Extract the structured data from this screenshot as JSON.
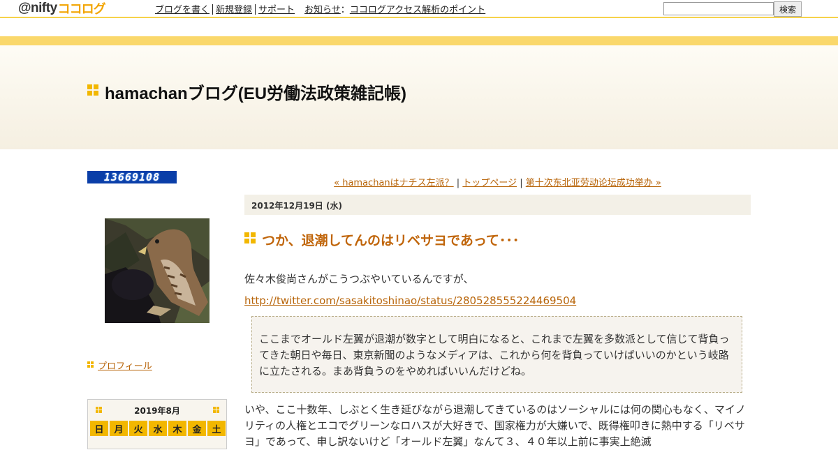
{
  "topbar": {
    "logo_prefix": "@nifty",
    "logo_suffix": "ココログ",
    "nav": [
      "ブログを書く",
      "新規登録",
      "サポート"
    ],
    "news_label": "お知らせ",
    "news_colon": "：",
    "news_link": "ココログアクセス解析のポイント",
    "search_placeholder": "",
    "search_button": "検索"
  },
  "blog": {
    "title": "hamachanブログ(EU労働法政策雑記帳)"
  },
  "sidebar": {
    "counter": "13669108",
    "profile_link": "プロフィール",
    "calendar": {
      "title": "2019年8月",
      "weekdays": [
        "日",
        "月",
        "火",
        "水",
        "木",
        "金",
        "土"
      ]
    }
  },
  "post_nav": {
    "prev": "« hamachanはナチス左派？",
    "sep": "|",
    "top": "トップページ",
    "next": "第十次东北亚劳动论坛成功举办 »"
  },
  "post": {
    "date": "2012年12月19日 (水)",
    "title": "つか、退潮してんのはリベサヨであって･･･",
    "intro": "佐々木俊尚さんがこうつぶやいているんですが、",
    "link": "http://twitter.com/sasakitoshinao/status/280528555224469504",
    "quote": "ここまでオールド左翼が退潮が数字として明白になると、これまで左翼を多数派として信じて背負ってきた朝日や毎日、東京新聞のようなメディアは、これから何を背負っていけばいいのかという岐路に立たされる。まあ背負うのをやめればいいんだけどね。",
    "body": "いや、ここ十数年、しぶとく生き延びながら退潮してきているのはソーシャルには何の関心もなく、マイノリティの人権とエコでグリーンなロハスが大好きで、国家権力が大嫌いで、既得権叩きに熱中する「リベサヨ」であって、申し訳ないけど「オールド左翼」なんて３、４０年以上前に事実上絶滅"
  },
  "colors": {
    "accent": "#f2b700",
    "link": "#b8650a",
    "title": "#c0650a",
    "stripe": "#fad86b"
  }
}
